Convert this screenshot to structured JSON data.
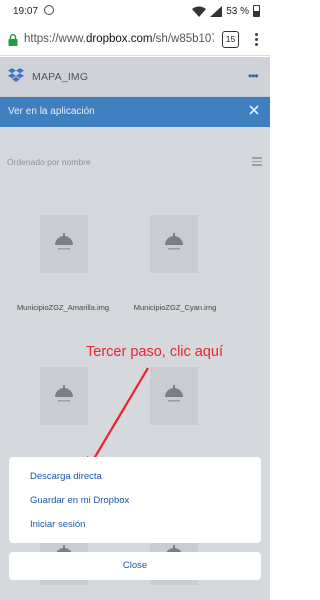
{
  "status_bar": {
    "time": "19:07",
    "battery": "53 %"
  },
  "browser": {
    "url_prefix": "https://www.",
    "url_domain": "dropbox.com",
    "url_path": "/sh/w85b107g",
    "tab_count": "15"
  },
  "app_header": {
    "title": "MAPA_IMG"
  },
  "banner": {
    "text": "Ver en la aplicación"
  },
  "sort": {
    "label": "Ordenado por nombre"
  },
  "files": [
    {
      "name": "MunicipioZGZ_Amarilla.img"
    },
    {
      "name": "MunicipioZGZ_Cyan.img"
    }
  ],
  "annotation": {
    "text": "Tercer paso, clic aquí",
    "color": "#e8242e"
  },
  "action_sheet": {
    "items": [
      "Descarga directa",
      "Guardar en mi Dropbox",
      "Iniciar sesión"
    ],
    "close_label": "Close"
  },
  "colors": {
    "accent": "#1f55a5",
    "banner": "#3e7fc0"
  }
}
